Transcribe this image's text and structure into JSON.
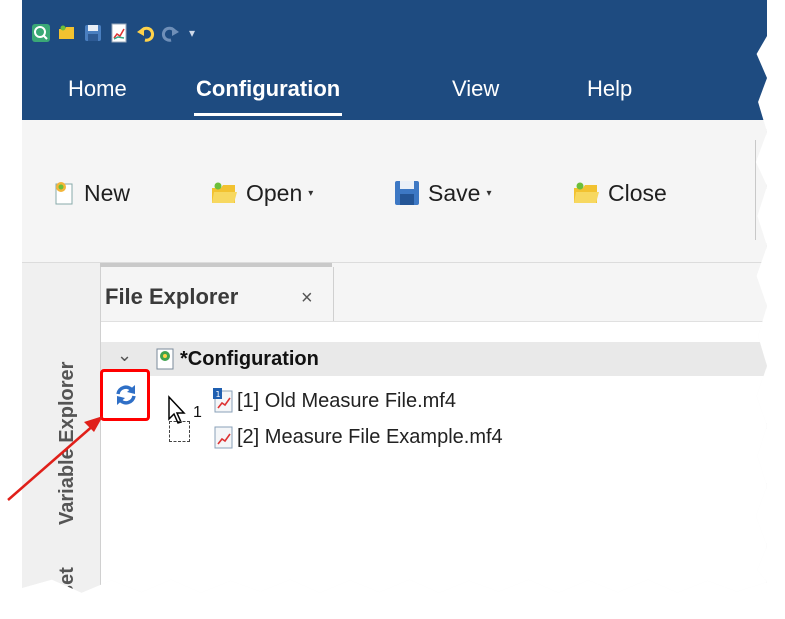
{
  "quick_access": {
    "icons": [
      "app-logo-icon",
      "open-folder-icon",
      "save-icon",
      "report-icon",
      "undo-icon",
      "redo-icon"
    ],
    "more_label": "▾"
  },
  "menu": {
    "tabs": [
      {
        "label": "Home",
        "active": false
      },
      {
        "label": "Configuration",
        "active": true
      },
      {
        "label": "View",
        "active": false
      },
      {
        "label": "Help",
        "active": false
      }
    ]
  },
  "ribbon": {
    "new_label": "New",
    "open_label": "Open",
    "save_label": "Save",
    "close_label": "Close",
    "dropdown_caret": "▾"
  },
  "side_tabs": {
    "variable_explorer": "Variable Explorer",
    "second_tab": "set"
  },
  "file_explorer": {
    "title": "File Explorer",
    "close_glyph": "×",
    "root": {
      "twisty": "⌄",
      "label": "*Configuration"
    },
    "files": [
      {
        "label": "[1] Old Measure File.mf4"
      },
      {
        "label": "[2] Measure File Example.mf4"
      }
    ],
    "drag_count": "1"
  },
  "colors": {
    "titlebar": "#1e4b80",
    "highlight_box": "#ff0000",
    "arrow": "#e0201a"
  }
}
